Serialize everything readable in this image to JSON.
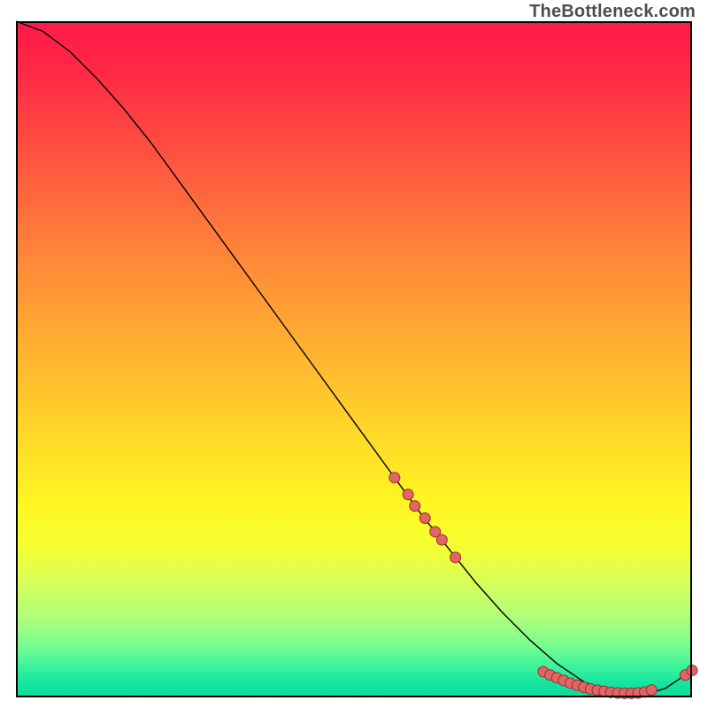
{
  "watermark": "TheBottleneck.com",
  "chart_data": {
    "type": "line",
    "title": "",
    "xlabel": "",
    "ylabel": "",
    "x_range": [
      0,
      100
    ],
    "y_range": [
      0,
      100
    ],
    "series": [
      {
        "name": "curve",
        "x": [
          0,
          4,
          8,
          12,
          16,
          20,
          24,
          28,
          32,
          36,
          40,
          44,
          48,
          52,
          56,
          60,
          64,
          68,
          72,
          76,
          80,
          84,
          88,
          92,
          96,
          100
        ],
        "y": [
          100,
          98.5,
          95.5,
          91.5,
          87,
          82,
          76.5,
          71,
          65.5,
          60,
          54.5,
          49,
          43.5,
          38,
          32.5,
          27,
          22,
          17,
          12.5,
          8.5,
          5,
          2.3,
          0.8,
          0.2,
          1.3,
          4.0
        ]
      }
    ],
    "markers": [
      {
        "x": 56,
        "y": 32.5
      },
      {
        "x": 58,
        "y": 30.0
      },
      {
        "x": 59,
        "y": 28.3
      },
      {
        "x": 60.5,
        "y": 26.5
      },
      {
        "x": 62,
        "y": 24.5
      },
      {
        "x": 63,
        "y": 23.3
      },
      {
        "x": 65,
        "y": 20.7
      },
      {
        "x": 78,
        "y": 3.8
      },
      {
        "x": 79,
        "y": 3.3
      },
      {
        "x": 80,
        "y": 2.9
      },
      {
        "x": 81,
        "y": 2.5
      },
      {
        "x": 82,
        "y": 2.1
      },
      {
        "x": 83,
        "y": 1.8
      },
      {
        "x": 84,
        "y": 1.5
      },
      {
        "x": 85,
        "y": 1.25
      },
      {
        "x": 86,
        "y": 1.05
      },
      {
        "x": 87,
        "y": 0.9
      },
      {
        "x": 88,
        "y": 0.75
      },
      {
        "x": 89,
        "y": 0.65
      },
      {
        "x": 90,
        "y": 0.6
      },
      {
        "x": 91,
        "y": 0.6
      },
      {
        "x": 92,
        "y": 0.65
      },
      {
        "x": 93,
        "y": 0.8
      },
      {
        "x": 94,
        "y": 1.1
      },
      {
        "x": 99,
        "y": 3.3
      },
      {
        "x": 100,
        "y": 4.0
      }
    ],
    "marker_style": {
      "fill": "#e06666",
      "stroke": "#9a2f2f",
      "r": 6
    },
    "line_style": {
      "stroke": "#000000",
      "width": 1.4
    }
  }
}
